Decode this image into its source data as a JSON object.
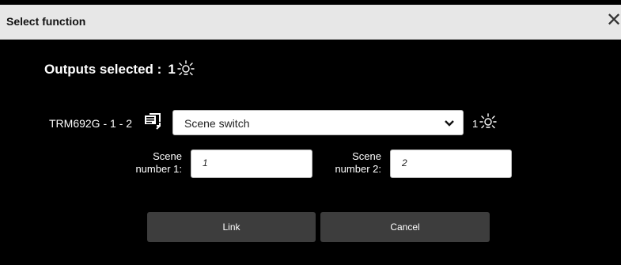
{
  "dialog": {
    "title": "Select function",
    "close_glyph": "✕"
  },
  "outputs": {
    "label": "Outputs selected :",
    "count": "1",
    "icon": "lamp-icon"
  },
  "row": {
    "device_label": "TRM692G - 1 - 2",
    "device_icon": "device-assign-icon",
    "function_select": {
      "value": "Scene switch",
      "icon": "chevron-down-icon"
    },
    "selected_count": "1",
    "selected_icon": "lamp-icon"
  },
  "scene_fields": [
    {
      "label_line1": "Scene",
      "label_line2": "number 1:",
      "value": "1"
    },
    {
      "label_line1": "Scene",
      "label_line2": "number 2:",
      "value": "2"
    }
  ],
  "buttons": {
    "link": "Link",
    "cancel": "Cancel"
  },
  "colors": {
    "background": "#000000",
    "titlebar": "#e7e7e7",
    "button": "#3d3d3d"
  }
}
